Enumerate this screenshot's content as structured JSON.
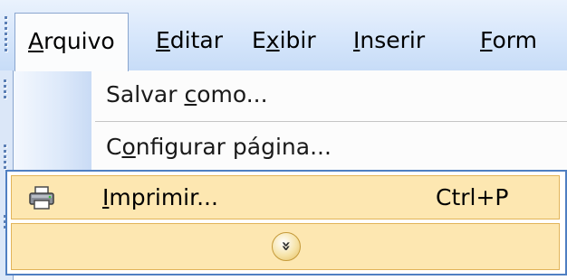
{
  "menubar": {
    "items": [
      {
        "accel": "A",
        "rest": "rquivo"
      },
      {
        "accel": "E",
        "rest": "ditar"
      },
      {
        "pre": "E",
        "accel": "x",
        "rest": "ibir"
      },
      {
        "accel": "I",
        "rest": "nserir"
      },
      {
        "accel": "F",
        "rest": "orm"
      }
    ]
  },
  "dropdown": {
    "save_as": {
      "pre": "Salvar ",
      "accel": "c",
      "rest": "omo..."
    },
    "page_setup": {
      "pre": "C",
      "accel": "o",
      "rest": "nfigurar página..."
    },
    "print": {
      "accel": "I",
      "rest": "mprimir...",
      "shortcut": "Ctrl+P",
      "icon": "printer-icon"
    },
    "expand": {
      "icon": "chevron-double-down-icon",
      "glyph": "»"
    }
  },
  "colors": {
    "menubar_bg": "#d6e6fb",
    "highlight_bg": "#fde7b1",
    "highlight_border": "#e2b459",
    "focus_border": "#4f7fc2"
  }
}
